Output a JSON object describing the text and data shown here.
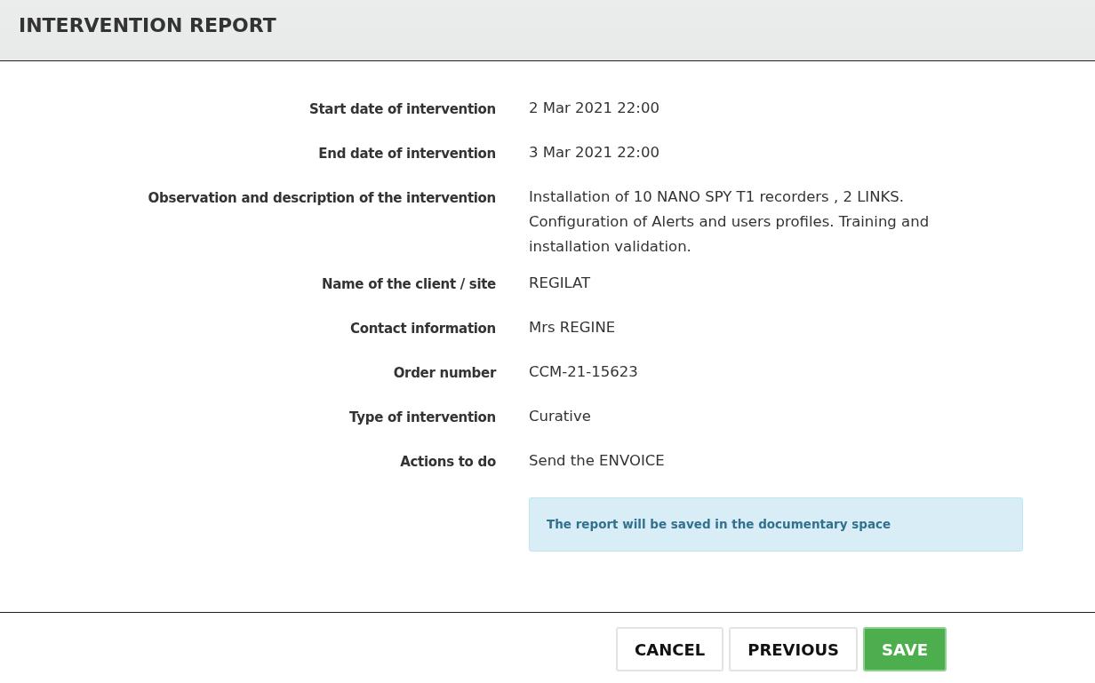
{
  "dialog": {
    "title": "INTERVENTION REPORT",
    "fields": [
      {
        "label": "Start date of intervention",
        "value": "2 Mar 2021 22:00"
      },
      {
        "label": "End date of intervention",
        "value": "3 Mar 2021 22:00"
      },
      {
        "label": "Observation and description of the intervention",
        "value": "Installation of 10 NANO SPY T1 recorders , 2 LINKS. Configuration of Alerts and users profiles. Training and installation validation."
      },
      {
        "label": "Name of the client / site",
        "value": "REGILAT"
      },
      {
        "label": "Contact information",
        "value": "Mrs REGINE"
      },
      {
        "label": "Order number",
        "value": "CCM-21-15623"
      },
      {
        "label": "Type of intervention",
        "value": "Curative"
      },
      {
        "label": "Actions to do",
        "value": "Send the ENVOICE"
      }
    ],
    "info": "The report will be saved in the documentary space",
    "buttons": [
      {
        "label": "CANCEL",
        "kind": "default"
      },
      {
        "label": "PREVIOUS",
        "kind": "default"
      },
      {
        "label": "SAVE",
        "kind": "primary"
      }
    ]
  }
}
